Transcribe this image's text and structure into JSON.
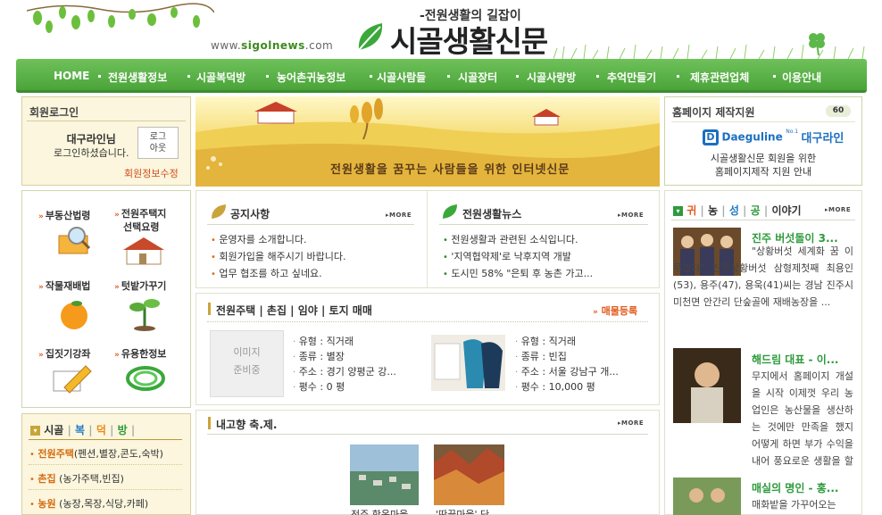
{
  "header": {
    "slogan": "-전원생활의 길잡이",
    "title": "시골생활신문",
    "url_prefix": "www.",
    "url_brand": "sigolnews",
    "url_suffix": ".com"
  },
  "nav": [
    "HOME",
    "전원생활정보",
    "시골복덕방",
    "농어촌귀농정보",
    "시골사람들",
    "시골장터",
    "시골사랑방",
    "추억만들기",
    "제휴관련업체",
    "이용안내"
  ],
  "login": {
    "title": "회원로그인",
    "user": "대구라인님",
    "message": "로그인하셨습니다.",
    "logout_line1": "로그",
    "logout_line2": "아웃",
    "edit": "회원정보수정"
  },
  "banner": {
    "tagline": "전원생활을 꿈꾸는 사람들을 위한 인터넷신문"
  },
  "support": {
    "title": "홈페이지 제작지원",
    "badge": "60",
    "logo_en": "Daeguline",
    "logo_no": "No.1",
    "logo_kr": "대구라인",
    "line1": "시골생활신문 회원을 위한",
    "line2": "홈페이지제작 지원 안내"
  },
  "quick": [
    {
      "label": "부동산법령",
      "icon": "magnifier-book-icon"
    },
    {
      "label": "전원주택지",
      "label2": "선택요령",
      "icon": "house-icon"
    },
    {
      "label": "작물재배법",
      "icon": "orange-icon"
    },
    {
      "label": "텃밭가꾸기",
      "icon": "sprout-icon"
    },
    {
      "label": "집짓기강좌",
      "icon": "pencil-icon"
    },
    {
      "label": "유용한정보",
      "icon": "coil-icon"
    }
  ],
  "category": {
    "title": {
      "a": "시골",
      "b": "복",
      "c": "덕",
      "d": "방"
    },
    "items": [
      {
        "head": "전원주택",
        "desc": "(펜션,별장,콘도,숙박)"
      },
      {
        "head": "촌집",
        "desc": "(농가주택,빈집)"
      },
      {
        "head": "농원",
        "desc": "(농장,목장,식당,카페)"
      }
    ]
  },
  "notice": {
    "title": "공지사항",
    "more": "MORE",
    "items": [
      "운영자를 소개합니다.",
      "회원가입을 해주시기 바랍니다.",
      "업무 협조를 하고 싶네요."
    ]
  },
  "news": {
    "title": "전원생활뉴스",
    "more": "MORE",
    "items": [
      "전원생활과 관련된 소식입니다.",
      "'지역협약제'로 낙후지역 개발",
      "도시민 58% \"은퇴 후 농촌 가고..."
    ]
  },
  "estate": {
    "title": "전원주택 | 촌집 | 임야 | 토지 매매",
    "register": "매물등록",
    "noimage_line1": "이미지",
    "noimage_line2": "준비중",
    "listings": [
      {
        "type": "유형 : 직거래",
        "kind": "종류 : 별장",
        "addr": "주소 : 경기 양평군 강...",
        "size": "평수 : 0 평"
      },
      {
        "type": "유형 : 직거래",
        "kind": "종류 : 빈집",
        "addr": "주소 : 서울 강남구 개...",
        "size": "평수 : 10,000 평"
      }
    ]
  },
  "festival": {
    "title": "내고향 축.제.",
    "more": "MORE",
    "captions": [
      "전주 한옥마을",
      "'딴끝마을' 단"
    ]
  },
  "story": {
    "title": {
      "a": "귀",
      "b": "농",
      "c": "성",
      "d": "공",
      "e": "이야기"
    },
    "more": "MORE",
    "items": [
      {
        "headline": "진주 버섯돌이 3...",
        "body": "\"상황버섯 세계화 꿈 이루겠다\" 진주상황버섯 삼형제첫째 최용인(53), 용주(47), 용욱(41)씨는 경남 진주시 미천면 안간리 단숲골에 재배농장을 ..."
      },
      {
        "headline": "해드림 대표 - 이...",
        "body": "무지에서 홈페이지 개설을 시작 이제껏 우리 농업인은 농산물을 생산하는 것에만 만족을 했지 어떻게 하면 부가 수익을 내어 풍요로운 생활을 할 ..."
      },
      {
        "headline": "매실의 명인 - 홍...",
        "body": "매화밭을 가꾸어오는"
      }
    ]
  },
  "colors": {
    "nav_green": "#52aa3e",
    "accent_orange": "#e05a1c",
    "story_green": "#2e9a3c"
  }
}
